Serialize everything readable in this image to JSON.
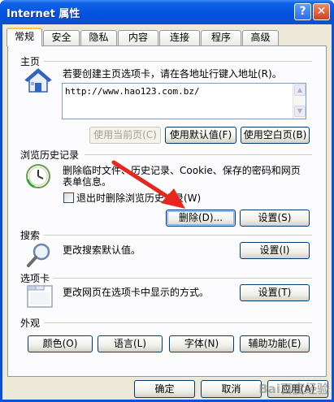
{
  "window": {
    "title": "Internet 属性"
  },
  "title_buttons": {
    "help": "?",
    "close": "✕"
  },
  "tabs": [
    {
      "label": "常规",
      "active": true
    },
    {
      "label": "安全"
    },
    {
      "label": "隐私"
    },
    {
      "label": "内容"
    },
    {
      "label": "连接"
    },
    {
      "label": "程序"
    },
    {
      "label": "高级"
    }
  ],
  "home": {
    "title": "主页",
    "desc": "若要创建主页选项卡，请在各地址行键入地址(R)。",
    "url": "http://www.hao123.com.bz/",
    "use_current": "使用当前页(C)",
    "use_default": "使用默认值(F)",
    "use_blank": "使用空白页(B)"
  },
  "history": {
    "title": "浏览历史记录",
    "desc_line1": "删除临时文件、历史记录、Cookie、保存的密码和网页",
    "desc_line2": "表单信息。",
    "checkbox": "退出时删除浏览历史记录(W)",
    "delete": "删除(D)...",
    "settings": "设置(S)"
  },
  "search": {
    "title": "搜索",
    "desc": "更改搜索默认值。",
    "settings": "设置(I)"
  },
  "tabs_section": {
    "title": "选项卡",
    "desc": "更改网页在选项卡中显示的方式。",
    "settings": "设置(T)"
  },
  "appearance": {
    "title": "外观",
    "colors": "颜色(O)",
    "languages": "语言(L)",
    "fonts": "字体(N)",
    "accessibility": "辅助功能(E)"
  },
  "footer": {
    "ok": "确定",
    "cancel": "取消",
    "apply": "应用(A)"
  },
  "watermark": "Bai百度经验",
  "colors": {
    "titlebar": "#0553e1",
    "dialog": "#ece9d8",
    "arrow": "#e8261b"
  }
}
